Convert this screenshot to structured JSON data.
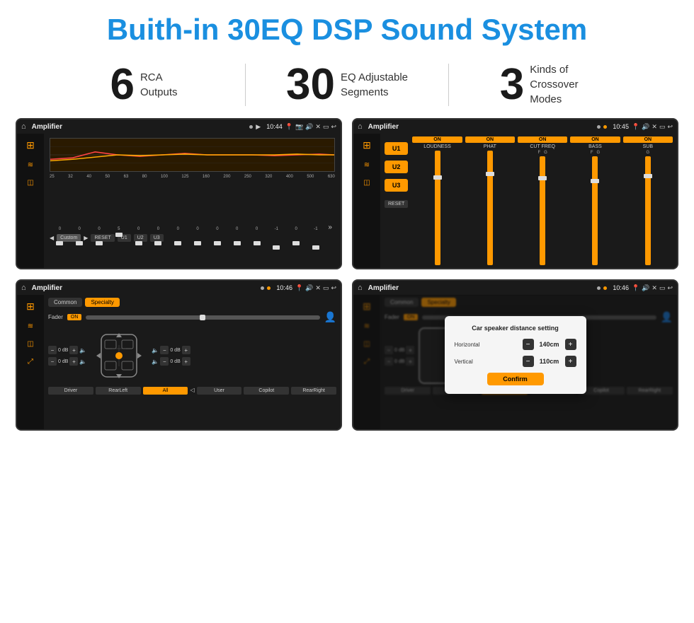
{
  "title": "Buith-in 30EQ DSP Sound System",
  "stats": [
    {
      "number": "6",
      "line1": "RCA",
      "line2": "Outputs"
    },
    {
      "number": "30",
      "line1": "EQ Adjustable",
      "line2": "Segments"
    },
    {
      "number": "3",
      "line1": "Kinds of",
      "line2": "Crossover Modes"
    }
  ],
  "screens": [
    {
      "id": "eq-screen",
      "statusBar": {
        "app": "Amplifier",
        "time": "10:44"
      },
      "type": "eq"
    },
    {
      "id": "crossover-screen",
      "statusBar": {
        "app": "Amplifier",
        "time": "10:45"
      },
      "type": "crossover"
    },
    {
      "id": "fader-screen",
      "statusBar": {
        "app": "Amplifier",
        "time": "10:46"
      },
      "type": "fader"
    },
    {
      "id": "distance-screen",
      "statusBar": {
        "app": "Amplifier",
        "time": "10:46"
      },
      "type": "distance",
      "dialog": {
        "title": "Car speaker distance setting",
        "horizontal": {
          "label": "Horizontal",
          "value": "140cm"
        },
        "vertical": {
          "label": "Vertical",
          "value": "110cm"
        },
        "confirm": "Confirm"
      }
    }
  ],
  "eqBands": [
    "25",
    "32",
    "40",
    "50",
    "63",
    "80",
    "100",
    "125",
    "160",
    "200",
    "250",
    "320",
    "400",
    "500",
    "630"
  ],
  "eqValues": [
    "0",
    "0",
    "0",
    "5",
    "0",
    "0",
    "0",
    "0",
    "0",
    "0",
    "0",
    "-1",
    "0",
    "-1"
  ],
  "crossoverChannels": [
    {
      "name": "LOUDNESS",
      "on": true
    },
    {
      "name": "PHAT",
      "on": true
    },
    {
      "name": "CUT FREQ",
      "on": true
    },
    {
      "name": "BASS",
      "on": true
    },
    {
      "name": "SUB",
      "on": true
    }
  ],
  "uButtons": [
    "U1",
    "U2",
    "U3"
  ],
  "fader": {
    "tabs": [
      "Common",
      "Specialty"
    ],
    "activeTab": "Specialty",
    "faderLabel": "Fader",
    "onLabel": "ON",
    "buttons": {
      "driver": "Driver",
      "rearLeft": "RearLeft",
      "all": "All",
      "copilot": "Copilot",
      "rearRight": "RearRight",
      "user": "User"
    }
  },
  "distanceSetting": {
    "title": "Car speaker distance setting",
    "horizontalLabel": "Horizontal",
    "horizontalValue": "140cm",
    "verticalLabel": "Vertical",
    "verticalValue": "110cm",
    "confirmLabel": "Confirm",
    "dBValues": [
      "0 dB",
      "0 dB",
      "0 dB",
      "0 dB"
    ]
  }
}
